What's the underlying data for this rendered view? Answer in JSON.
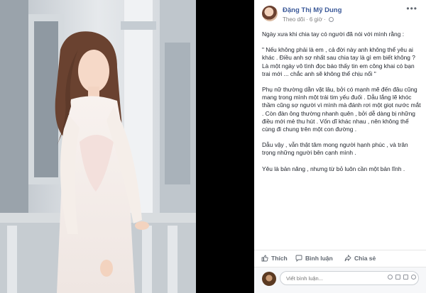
{
  "post": {
    "author": "Đặng Thị Mỹ Dung",
    "follow_label": "Theo dõi",
    "time": "6 giờ",
    "more": "•••",
    "paragraphs": [
      "Ngày xưa khi chia tay có người đã nói với mình rằng :",
      "\" Nếu không phải là em , cả đời này anh không thể yêu ai khác . Điều anh sợ nhất sau chia tay là gì em biết không ? Là một ngày vô tình đọc báo thấy tin em công khai có bạn trai mới ... chắc anh sẽ không thể chịu nổi \"",
      "Phụ nữ thường dằn vặt lâu, bởi có mạnh mẽ đến đâu cũng mang trong mình một trái tim yếu đuối . Dẫu lắng lẽ khóc thầm cũng sợ người vì mình mà đánh rơi một giọt nước mắt . Còn đàn ông thường nhanh quên , bởi dễ dàng bị những điều mới mẻ thu hút . Vốn dĩ khác nhau , nên không thể cùng đi chung trên một con đường .",
      "Dẫu vậy , vẫn thật tâm mong người hạnh phúc , và trân trọng những người bên cạnh mình .",
      "Yêu là bản năng , nhưng từ bỏ luôn cần một bản lĩnh ."
    ]
  },
  "actions": {
    "like": "Thích",
    "comment": "Bình luận",
    "share": "Chia sẻ"
  },
  "comment_box": {
    "placeholder": "Viết bình luận..."
  },
  "colors": {
    "author_link": "#3b5998",
    "action_text": "#606770",
    "body_text": "#1d2129"
  }
}
